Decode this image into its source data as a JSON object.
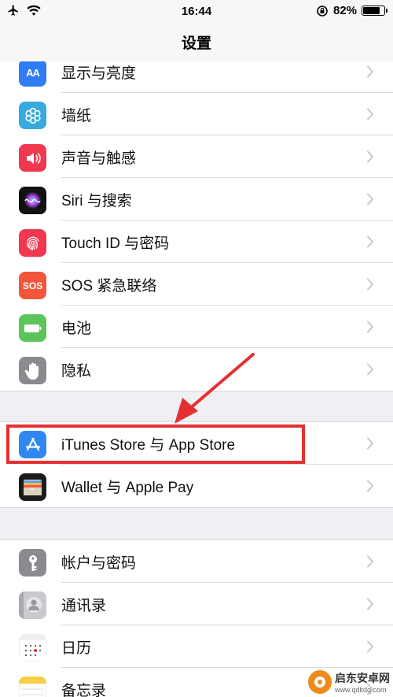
{
  "status_bar": {
    "time": "16:44",
    "battery_percent": "82%",
    "battery_level": 0.82
  },
  "nav": {
    "title": "设置"
  },
  "groups": [
    {
      "items": [
        {
          "label": "显示与亮度",
          "icon": "display-brightness-icon",
          "color": "#2f7cf6",
          "glyph": "AA"
        },
        {
          "label": "墙纸",
          "icon": "wallpaper-icon",
          "color": "#36aadc",
          "glyph": ""
        },
        {
          "label": "声音与触感",
          "icon": "sound-icon",
          "color": "#f0384f",
          "glyph": ""
        },
        {
          "label": "Siri 与搜索",
          "icon": "siri-icon",
          "color": "#1c1c2e",
          "glyph": ""
        },
        {
          "label": "Touch ID 与密码",
          "icon": "touch-id-icon",
          "color": "#f0384f",
          "glyph": ""
        },
        {
          "label": "SOS 紧急联络",
          "icon": "sos-icon",
          "color": "#f2553a",
          "glyph": "SOS"
        },
        {
          "label": "电池",
          "icon": "battery-icon",
          "color": "#5bc45a",
          "glyph": ""
        },
        {
          "label": "隐私",
          "icon": "privacy-hand-icon",
          "color": "#8a8a8f",
          "glyph": ""
        }
      ]
    },
    {
      "items": [
        {
          "label": "iTunes Store 与 App Store",
          "icon": "app-store-icon",
          "color": "#2f88f2",
          "glyph": ""
        },
        {
          "label": "Wallet 与 Apple Pay",
          "icon": "wallet-icon",
          "color": "#1c1c1e",
          "glyph": ""
        }
      ]
    },
    {
      "items": [
        {
          "label": "帐户与密码",
          "icon": "key-icon",
          "color": "#8a8a8f",
          "glyph": ""
        },
        {
          "label": "通讯录",
          "icon": "contacts-icon",
          "color": "#b9b9bf",
          "glyph": ""
        },
        {
          "label": "日历",
          "icon": "calendar-icon",
          "color": "#ffffff",
          "glyph": ""
        },
        {
          "label": "备忘录",
          "icon": "notes-icon",
          "color": "#ffffff",
          "glyph": ""
        }
      ]
    }
  ],
  "watermark": {
    "name": "启东安卓网",
    "url": "www.qdltdq.com"
  },
  "colors": {
    "highlight": "#e53033",
    "chevron": "#c7c7cc"
  }
}
